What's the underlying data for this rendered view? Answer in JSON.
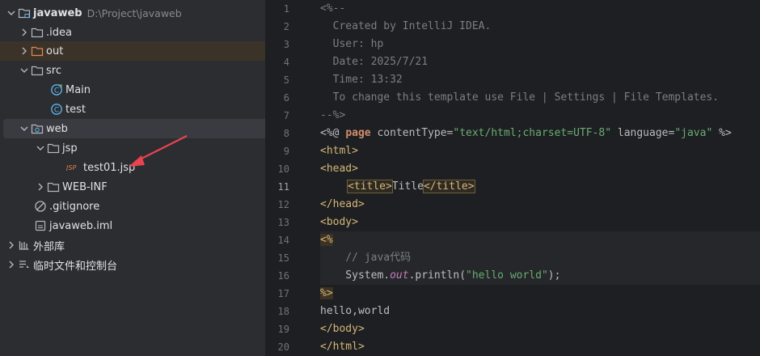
{
  "tree": {
    "root": {
      "name": "javaweb",
      "path": "D:\\Project\\javaweb"
    },
    "idea": ".idea",
    "out": "out",
    "src": "src",
    "main": "Main",
    "test": "test",
    "web": "web",
    "jsp": "jsp",
    "test01": "test01.jsp",
    "webinf": "WEB-INF",
    "gitignore": ".gitignore",
    "iml": "javaweb.iml",
    "external": "外部库",
    "scratches": "临时文件和控制台"
  },
  "gutter": {
    "lines": [
      "1",
      "2",
      "3",
      "4",
      "5",
      "6",
      "7",
      "8",
      "9",
      "10",
      "11",
      "12",
      "13",
      "14",
      "15",
      "16",
      "17",
      "18",
      "19",
      "20"
    ],
    "current": "11"
  },
  "code": {
    "l1": "<%--",
    "l2": "  Created by IntelliJ IDEA.",
    "l3": "  User: hp",
    "l4": "  Date: 2025/7/21",
    "l5": "  Time: 13:32",
    "l6": "  To change this template use File | Settings | File Templates.",
    "l7": "--%>",
    "l8": {
      "open": "<%@ ",
      "dir": "page",
      "attr1": " contentType=",
      "val1": "\"text/html;charset=UTF-8\"",
      "attr2": " language=",
      "val2": "\"java\"",
      "close": " %>"
    },
    "l9": "<html>",
    "l10": "<head>",
    "l11": {
      "open": "<title>",
      "text": "Title",
      "close": "</title>"
    },
    "l12": "</head>",
    "l13": "<body>",
    "l14": "<%",
    "l15": "    // java代码",
    "l16": {
      "pre": "    System.",
      "field": "out",
      "mid": ".println(",
      "str": "\"hello world\"",
      "end": ");"
    },
    "l17": "%>",
    "l18": "hello,world",
    "l19": "</body>",
    "l20": "</html>"
  },
  "colors": {
    "sidebar_bg": "#2b2d30",
    "editor_bg": "#1e1f22",
    "tag": "#d5b778",
    "string": "#6aab73",
    "keyword": "#cf8e6d",
    "comment": "#7a7e85",
    "arrow": "#e8434f"
  }
}
